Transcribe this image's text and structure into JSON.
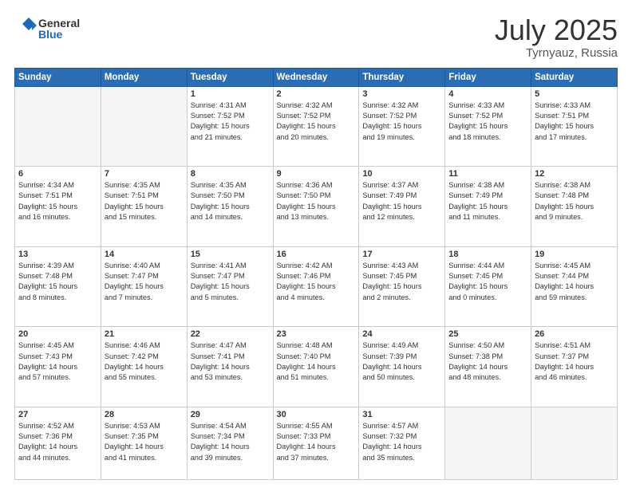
{
  "header": {
    "logo_general": "General",
    "logo_blue": "Blue",
    "title_month": "July 2025",
    "title_location": "Tyrnyauz, Russia"
  },
  "weekdays": [
    "Sunday",
    "Monday",
    "Tuesday",
    "Wednesday",
    "Thursday",
    "Friday",
    "Saturday"
  ],
  "weeks": [
    [
      {
        "day": "",
        "info": ""
      },
      {
        "day": "",
        "info": ""
      },
      {
        "day": "1",
        "info": "Sunrise: 4:31 AM\nSunset: 7:52 PM\nDaylight: 15 hours\nand 21 minutes."
      },
      {
        "day": "2",
        "info": "Sunrise: 4:32 AM\nSunset: 7:52 PM\nDaylight: 15 hours\nand 20 minutes."
      },
      {
        "day": "3",
        "info": "Sunrise: 4:32 AM\nSunset: 7:52 PM\nDaylight: 15 hours\nand 19 minutes."
      },
      {
        "day": "4",
        "info": "Sunrise: 4:33 AM\nSunset: 7:52 PM\nDaylight: 15 hours\nand 18 minutes."
      },
      {
        "day": "5",
        "info": "Sunrise: 4:33 AM\nSunset: 7:51 PM\nDaylight: 15 hours\nand 17 minutes."
      }
    ],
    [
      {
        "day": "6",
        "info": "Sunrise: 4:34 AM\nSunset: 7:51 PM\nDaylight: 15 hours\nand 16 minutes."
      },
      {
        "day": "7",
        "info": "Sunrise: 4:35 AM\nSunset: 7:51 PM\nDaylight: 15 hours\nand 15 minutes."
      },
      {
        "day": "8",
        "info": "Sunrise: 4:35 AM\nSunset: 7:50 PM\nDaylight: 15 hours\nand 14 minutes."
      },
      {
        "day": "9",
        "info": "Sunrise: 4:36 AM\nSunset: 7:50 PM\nDaylight: 15 hours\nand 13 minutes."
      },
      {
        "day": "10",
        "info": "Sunrise: 4:37 AM\nSunset: 7:49 PM\nDaylight: 15 hours\nand 12 minutes."
      },
      {
        "day": "11",
        "info": "Sunrise: 4:38 AM\nSunset: 7:49 PM\nDaylight: 15 hours\nand 11 minutes."
      },
      {
        "day": "12",
        "info": "Sunrise: 4:38 AM\nSunset: 7:48 PM\nDaylight: 15 hours\nand 9 minutes."
      }
    ],
    [
      {
        "day": "13",
        "info": "Sunrise: 4:39 AM\nSunset: 7:48 PM\nDaylight: 15 hours\nand 8 minutes."
      },
      {
        "day": "14",
        "info": "Sunrise: 4:40 AM\nSunset: 7:47 PM\nDaylight: 15 hours\nand 7 minutes."
      },
      {
        "day": "15",
        "info": "Sunrise: 4:41 AM\nSunset: 7:47 PM\nDaylight: 15 hours\nand 5 minutes."
      },
      {
        "day": "16",
        "info": "Sunrise: 4:42 AM\nSunset: 7:46 PM\nDaylight: 15 hours\nand 4 minutes."
      },
      {
        "day": "17",
        "info": "Sunrise: 4:43 AM\nSunset: 7:45 PM\nDaylight: 15 hours\nand 2 minutes."
      },
      {
        "day": "18",
        "info": "Sunrise: 4:44 AM\nSunset: 7:45 PM\nDaylight: 15 hours\nand 0 minutes."
      },
      {
        "day": "19",
        "info": "Sunrise: 4:45 AM\nSunset: 7:44 PM\nDaylight: 14 hours\nand 59 minutes."
      }
    ],
    [
      {
        "day": "20",
        "info": "Sunrise: 4:45 AM\nSunset: 7:43 PM\nDaylight: 14 hours\nand 57 minutes."
      },
      {
        "day": "21",
        "info": "Sunrise: 4:46 AM\nSunset: 7:42 PM\nDaylight: 14 hours\nand 55 minutes."
      },
      {
        "day": "22",
        "info": "Sunrise: 4:47 AM\nSunset: 7:41 PM\nDaylight: 14 hours\nand 53 minutes."
      },
      {
        "day": "23",
        "info": "Sunrise: 4:48 AM\nSunset: 7:40 PM\nDaylight: 14 hours\nand 51 minutes."
      },
      {
        "day": "24",
        "info": "Sunrise: 4:49 AM\nSunset: 7:39 PM\nDaylight: 14 hours\nand 50 minutes."
      },
      {
        "day": "25",
        "info": "Sunrise: 4:50 AM\nSunset: 7:38 PM\nDaylight: 14 hours\nand 48 minutes."
      },
      {
        "day": "26",
        "info": "Sunrise: 4:51 AM\nSunset: 7:37 PM\nDaylight: 14 hours\nand 46 minutes."
      }
    ],
    [
      {
        "day": "27",
        "info": "Sunrise: 4:52 AM\nSunset: 7:36 PM\nDaylight: 14 hours\nand 44 minutes."
      },
      {
        "day": "28",
        "info": "Sunrise: 4:53 AM\nSunset: 7:35 PM\nDaylight: 14 hours\nand 41 minutes."
      },
      {
        "day": "29",
        "info": "Sunrise: 4:54 AM\nSunset: 7:34 PM\nDaylight: 14 hours\nand 39 minutes."
      },
      {
        "day": "30",
        "info": "Sunrise: 4:55 AM\nSunset: 7:33 PM\nDaylight: 14 hours\nand 37 minutes."
      },
      {
        "day": "31",
        "info": "Sunrise: 4:57 AM\nSunset: 7:32 PM\nDaylight: 14 hours\nand 35 minutes."
      },
      {
        "day": "",
        "info": ""
      },
      {
        "day": "",
        "info": ""
      }
    ]
  ]
}
